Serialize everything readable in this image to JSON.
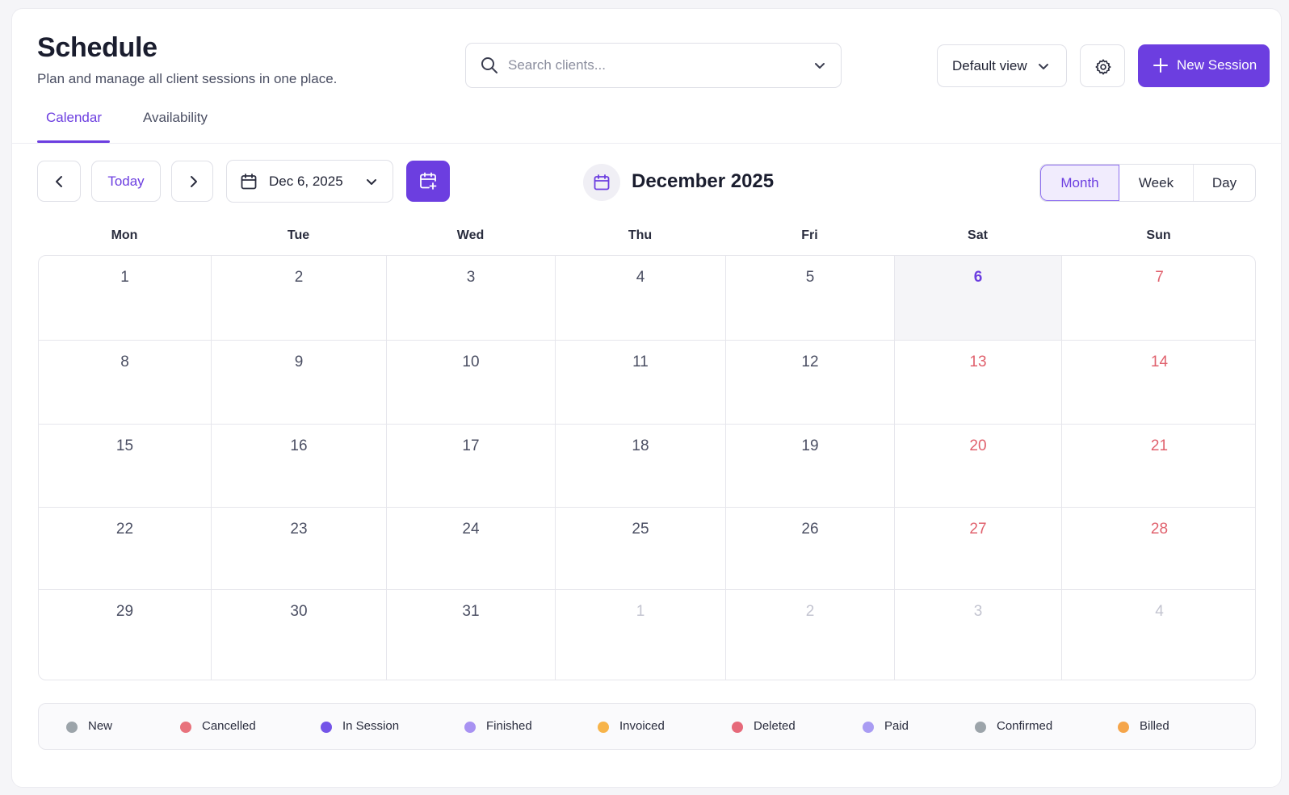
{
  "header": {
    "title": "Schedule",
    "subtitle": "Plan and manage all client sessions in one place."
  },
  "search": {
    "placeholder": "Search clients..."
  },
  "actions": {
    "default_view_label": "Default view",
    "new_session_label": "New Session"
  },
  "tabs": [
    {
      "label": "Calendar",
      "active": true
    },
    {
      "label": "Availability",
      "active": false
    }
  ],
  "toolbar": {
    "today_label": "Today",
    "date_value": "Dec 6, 2025",
    "month_label": "December 2025"
  },
  "views": [
    {
      "label": "Month",
      "active": true
    },
    {
      "label": "Week",
      "active": false
    },
    {
      "label": "Day",
      "active": false
    }
  ],
  "weekdays": [
    "Mon",
    "Tue",
    "Wed",
    "Thu",
    "Fri",
    "Sat",
    "Sun"
  ],
  "weeks": [
    [
      "1",
      "2",
      "3",
      "4",
      "5",
      "6",
      "7"
    ],
    [
      "8",
      "9",
      "10",
      "11",
      "12",
      "13",
      "14"
    ],
    [
      "15",
      "16",
      "17",
      "18",
      "19",
      "20",
      "21"
    ],
    [
      "22",
      "23",
      "24",
      "25",
      "26",
      "27",
      "28"
    ],
    [
      "29",
      "30",
      "31",
      "1",
      "2",
      "3",
      "4"
    ]
  ],
  "today_date": "6",
  "legend": [
    {
      "label": "New",
      "color": "#9ca4aa"
    },
    {
      "label": "Cancelled",
      "color": "#e8727c"
    },
    {
      "label": "In Session",
      "color": "#7454e8"
    },
    {
      "label": "Finished",
      "color": "#a892f2"
    },
    {
      "label": "Invoiced",
      "color": "#f7b44a"
    },
    {
      "label": "Deleted",
      "color": "#e6697a"
    },
    {
      "label": "Paid",
      "color": "#a99cf3"
    },
    {
      "label": "Confirmed",
      "color": "#9ca4aa"
    },
    {
      "label": "Billed",
      "color": "#f5a54a"
    }
  ],
  "colors": {
    "accent": "#6c3ee0",
    "weekend": "#e0616d",
    "muted": "#c3c4d0"
  }
}
